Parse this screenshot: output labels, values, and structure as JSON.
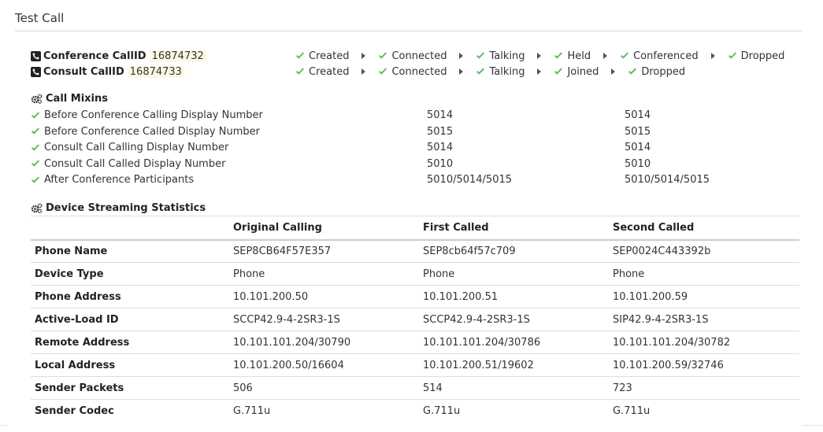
{
  "panel": {
    "title": "Test Call"
  },
  "calls": [
    {
      "label": "Conference CallID",
      "id": "16874732",
      "states": [
        "Created",
        "Connected",
        "Talking",
        "Held",
        "Conferenced",
        "Dropped"
      ]
    },
    {
      "label": "Consult CallID",
      "id": "16874733",
      "states": [
        "Created",
        "Connected",
        "Talking",
        "Joined",
        "Dropped"
      ]
    }
  ],
  "mixins": {
    "title": "Call Mixins",
    "items": [
      {
        "name": "Before Conference Calling Display Number",
        "expected": "5014",
        "actual": "5014"
      },
      {
        "name": "Before Conference Called Display Number",
        "expected": "5015",
        "actual": "5015"
      },
      {
        "name": "Consult Call Calling Display Number",
        "expected": "5014",
        "actual": "5014"
      },
      {
        "name": "Consult Call Called Display Number",
        "expected": "5010",
        "actual": "5010"
      },
      {
        "name": "After Conference Participants",
        "expected": "5010/5014/5015",
        "actual": "5010/5014/5015"
      }
    ]
  },
  "stats": {
    "title": "Device Streaming Statistics",
    "headers": [
      "",
      "Original Calling",
      "First Called",
      "Second Called"
    ],
    "rows": [
      [
        "Phone Name",
        "SEP8CB64F57E357",
        "SEP8cb64f57c709",
        "SEP0024C443392b"
      ],
      [
        "Device Type",
        "Phone",
        "Phone",
        "Phone"
      ],
      [
        "Phone Address",
        "10.101.200.50",
        "10.101.200.51",
        "10.101.200.59"
      ],
      [
        "Active-Load ID",
        "SCCP42.9-4-2SR3-1S",
        "SCCP42.9-4-2SR3-1S",
        "SIP42.9-4-2SR3-1S"
      ],
      [
        "Remote Address",
        "10.101.101.204/30790",
        "10.101.101.204/30786",
        "10.101.101.204/30782"
      ],
      [
        "Local Address",
        "10.101.200.50/16604",
        "10.101.200.51/19602",
        "10.101.200.59/32746"
      ],
      [
        "Sender Packets",
        "506",
        "514",
        "723"
      ],
      [
        "Sender Codec",
        "G.711u",
        "G.711u",
        "G.711u"
      ]
    ]
  },
  "icons": {
    "phone": "phone-square-icon",
    "check": "check-icon",
    "arrow": "caret-right-icon",
    "gears": "gears-icon"
  },
  "colors": {
    "check": "#5cb85c",
    "id_highlight": "#fcf8e3",
    "text": "#333333"
  }
}
